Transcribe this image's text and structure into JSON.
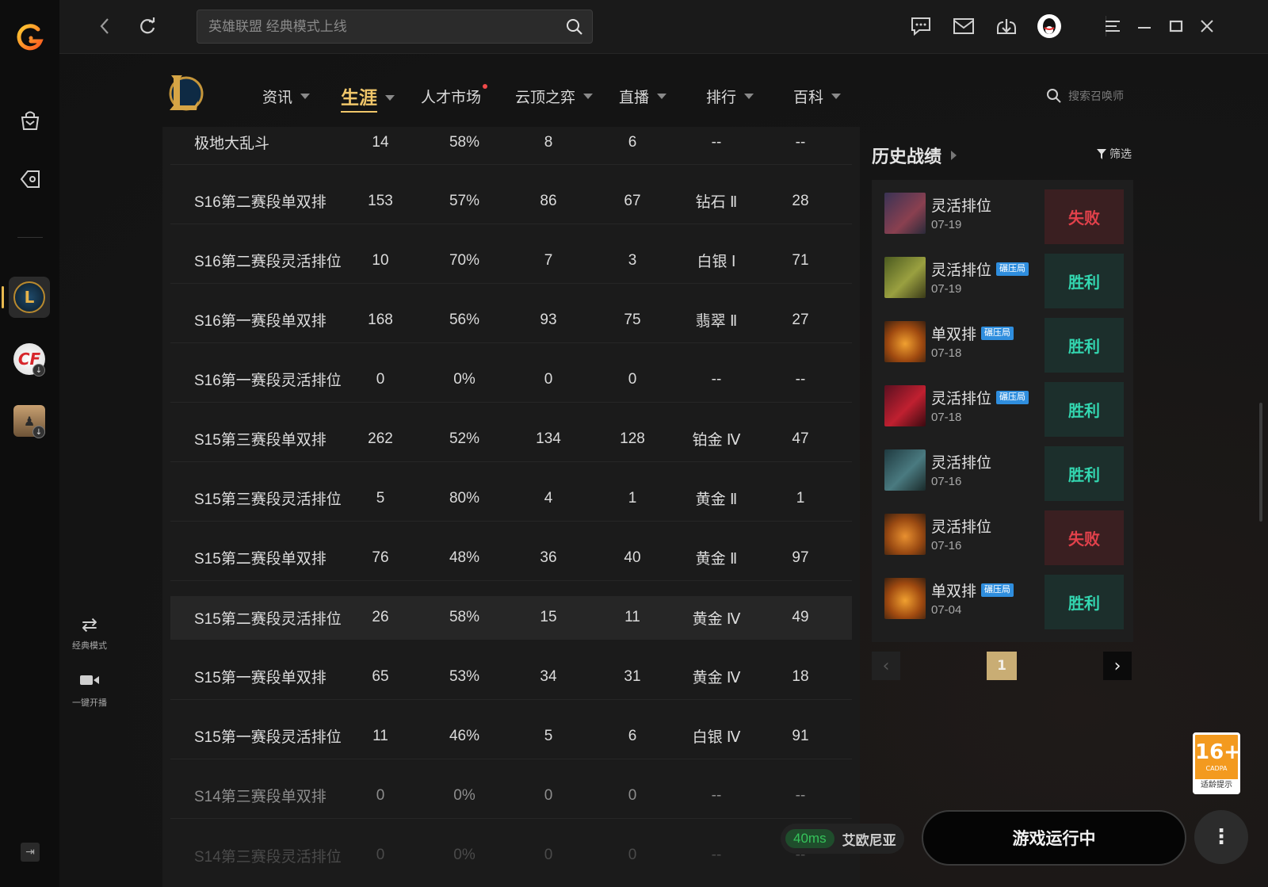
{
  "topbar": {
    "search_placeholder": "英雄联盟 经典模式上线"
  },
  "nav": {
    "items": [
      {
        "label": "资讯"
      },
      {
        "label": "生涯"
      },
      {
        "label": "人才市场"
      },
      {
        "label": "云顶之弈"
      },
      {
        "label": "直播"
      },
      {
        "label": "排行"
      },
      {
        "label": "百科"
      }
    ],
    "summoner_search_placeholder": "搜索召唤师"
  },
  "career_table": {
    "rows": [
      [
        "极地大乱斗",
        "14",
        "58%",
        "8",
        "6",
        "--",
        "--"
      ],
      [
        "S16第二赛段单双排",
        "153",
        "57%",
        "86",
        "67",
        "钻石 Ⅱ",
        "28"
      ],
      [
        "S16第二赛段灵活排位",
        "10",
        "70%",
        "7",
        "3",
        "白银 Ⅰ",
        "71"
      ],
      [
        "S16第一赛段单双排",
        "168",
        "56%",
        "93",
        "75",
        "翡翠 Ⅱ",
        "27"
      ],
      [
        "S16第一赛段灵活排位",
        "0",
        "0%",
        "0",
        "0",
        "--",
        "--"
      ],
      [
        "S15第三赛段单双排",
        "262",
        "52%",
        "134",
        "128",
        "铂金 Ⅳ",
        "47"
      ],
      [
        "S15第三赛段灵活排位",
        "5",
        "80%",
        "4",
        "1",
        "黄金 Ⅱ",
        "1"
      ],
      [
        "S15第二赛段单双排",
        "76",
        "48%",
        "36",
        "40",
        "黄金 Ⅱ",
        "97"
      ],
      [
        "S15第二赛段灵活排位",
        "26",
        "58%",
        "15",
        "11",
        "黄金 Ⅳ",
        "49"
      ],
      [
        "S15第一赛段单双排",
        "65",
        "53%",
        "34",
        "31",
        "黄金 Ⅳ",
        "18"
      ],
      [
        "S15第一赛段灵活排位",
        "11",
        "46%",
        "5",
        "6",
        "白银 Ⅳ",
        "91"
      ],
      [
        "S14第三赛段单双排",
        "0",
        "0%",
        "0",
        "0",
        "--",
        "--"
      ],
      [
        "S14第三赛段灵活排位",
        "0",
        "0%",
        "0",
        "0",
        "--",
        "--"
      ]
    ]
  },
  "history": {
    "title": "历史战绩",
    "filter_label": "筛选",
    "matches": [
      {
        "mode": "灵活排位",
        "tag": "",
        "date": "07-19",
        "result": "失败"
      },
      {
        "mode": "灵活排位",
        "tag": "碾压局",
        "date": "07-19",
        "result": "胜利"
      },
      {
        "mode": "单双排",
        "tag": "碾压局",
        "date": "07-18",
        "result": "胜利"
      },
      {
        "mode": "灵活排位",
        "tag": "碾压局",
        "date": "07-18",
        "result": "胜利"
      },
      {
        "mode": "灵活排位",
        "tag": "",
        "date": "07-16",
        "result": "胜利"
      },
      {
        "mode": "灵活排位",
        "tag": "",
        "date": "07-16",
        "result": "失败"
      },
      {
        "mode": "单双排",
        "tag": "碾压局",
        "date": "07-04",
        "result": "胜利"
      }
    ],
    "page": "1"
  },
  "tools": {
    "classic_mode": "经典模式",
    "one_click_stream": "一键开播"
  },
  "age_rating": {
    "value": "16+",
    "org": "CADPA",
    "note": "适龄提示"
  },
  "status": {
    "ping": "40ms",
    "server": "艾欧尼亚",
    "run_button": "游戏运行中"
  },
  "colors": {
    "accent_gold": "#f0c66a",
    "win": "#33d6b0",
    "lose": "#e2414b",
    "tag_blue": "#2f8ede"
  }
}
